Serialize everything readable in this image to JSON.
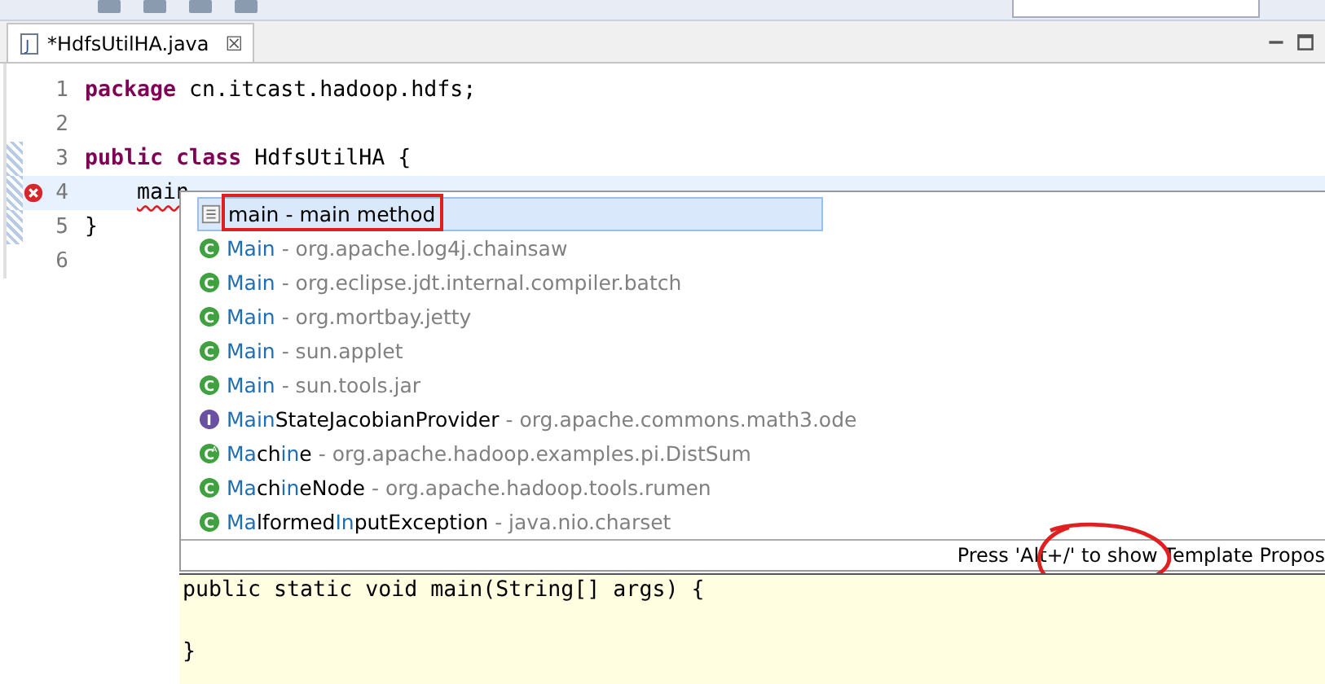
{
  "editor_tab": {
    "file_icon": "J",
    "title": "*HdfsUtilHA.java",
    "close": "☒",
    "selected": true
  },
  "code_lines": [
    {
      "number": "1",
      "current": false,
      "error": false,
      "changed": false,
      "tokens": [
        {
          "text": "package",
          "kind": "keyword"
        },
        {
          "text": "cn.itcast.hadoop.hdfs;",
          "kind": "plain"
        }
      ]
    },
    {
      "number": "2",
      "current": false,
      "error": false,
      "changed": false
    },
    {
      "number": "3",
      "current": false,
      "error": false,
      "changed": true,
      "tokens": [
        {
          "text": "public",
          "kind": "keyword"
        },
        {
          "text": "class",
          "kind": "keyword"
        },
        {
          "text": "HdfsUtilHA {",
          "kind": "plain"
        }
      ]
    },
    {
      "number": "4",
      "current": true,
      "error": true,
      "changed": true,
      "indented": true,
      "tokens": [
        {
          "text": "main",
          "kind": "squiggle"
        }
      ]
    },
    {
      "number": "5",
      "current": false,
      "error": false,
      "changed": true,
      "tokens": [
        {
          "text": "}",
          "kind": "plain"
        }
      ]
    },
    {
      "number": "6",
      "current": false,
      "error": false,
      "changed": false
    }
  ],
  "proposals": [
    {
      "kind": "template",
      "selected": true,
      "annotated": true,
      "name": [
        {
          "text": "main - main method",
          "match": false
        }
      ]
    },
    {
      "kind": "class",
      "icon_text": "C",
      "selected": false,
      "annotated": false,
      "name": [
        {
          "text": "Main",
          "match": true
        }
      ],
      "qualifier": " - org.apache.log4j.chainsaw"
    },
    {
      "kind": "class",
      "icon_text": "C",
      "selected": false,
      "annotated": false,
      "name": [
        {
          "text": "Main",
          "match": true
        }
      ],
      "qualifier": " - org.eclipse.jdt.internal.compiler.batch"
    },
    {
      "kind": "class",
      "icon_text": "C",
      "selected": false,
      "annotated": false,
      "name": [
        {
          "text": "Main",
          "match": true
        }
      ],
      "qualifier": " - org.mortbay.jetty"
    },
    {
      "kind": "class",
      "icon_text": "C",
      "selected": false,
      "annotated": false,
      "name": [
        {
          "text": "Main",
          "match": true
        }
      ],
      "qualifier": " - sun.applet"
    },
    {
      "kind": "class",
      "icon_text": "C",
      "selected": false,
      "annotated": false,
      "name": [
        {
          "text": "Main",
          "match": true
        }
      ],
      "qualifier": " - sun.tools.jar"
    },
    {
      "kind": "interface",
      "icon_text": "I",
      "selected": false,
      "annotated": false,
      "name": [
        {
          "text": "Main",
          "match": true
        },
        {
          "text": "StateJacobianProvider",
          "match": false
        }
      ],
      "qualifier": " - org.apache.commons.math3.ode"
    },
    {
      "kind": "abstract-class",
      "icon_text": "C",
      "icon_badge": "A",
      "selected": false,
      "annotated": false,
      "name": [
        {
          "text": "Ma",
          "match": true
        },
        {
          "text": "ch",
          "match": false
        },
        {
          "text": "in",
          "match": true
        },
        {
          "text": "e",
          "match": false
        }
      ],
      "qualifier": " - org.apache.hadoop.examples.pi.DistSum"
    },
    {
      "kind": "class",
      "icon_text": "C",
      "selected": false,
      "annotated": false,
      "name": [
        {
          "text": "Ma",
          "match": true
        },
        {
          "text": "ch",
          "match": false
        },
        {
          "text": "in",
          "match": true
        },
        {
          "text": "eNode",
          "match": false
        }
      ],
      "qualifier": " - org.apache.hadoop.tools.rumen"
    },
    {
      "kind": "class",
      "icon_text": "C",
      "selected": false,
      "annotated": false,
      "name": [
        {
          "text": "Ma",
          "match": true
        },
        {
          "text": "lformed",
          "match": false
        },
        {
          "text": "In",
          "match": true
        },
        {
          "text": "putException",
          "match": false
        }
      ],
      "qualifier": " - java.nio.charset"
    }
  ],
  "proposal_hint": {
    "text": "Press 'Alt+/' to show Template Propos",
    "circled": true
  },
  "preview_lines": [
    "public static void main(String[] args) {",
    "}"
  ]
}
